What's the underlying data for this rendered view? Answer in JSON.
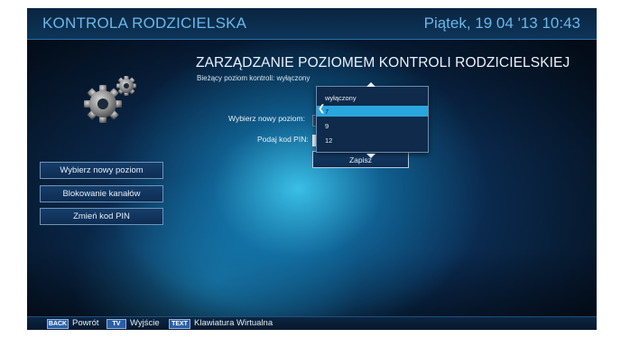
{
  "header": {
    "title": "KONTROLA RODZICIELSKA",
    "datetime": "Piątek, 19 04 '13 10:43"
  },
  "sidebar": {
    "items": [
      {
        "label": "Wybierz nowy poziom"
      },
      {
        "label": "Blokowanie kanałów"
      },
      {
        "label": "Zmień kod PIN"
      }
    ]
  },
  "main": {
    "title": "ZARZĄDZANIE POZIOMEM KONTROLI RODZICIELSKIEJ",
    "current_level": "Bieżący poziom kontroli: wyłączony",
    "select_level_label": "Wybierz nowy poziom:",
    "pin_label": "Podaj kod PIN:",
    "save_label": "Zapisz",
    "dropdown": {
      "options": [
        "wyłączony",
        "7",
        "9",
        "12"
      ],
      "highlighted": "7"
    }
  },
  "footer": {
    "hints": [
      {
        "key": "BACK",
        "label": "Powrót"
      },
      {
        "key": "TV",
        "label": "Wyjście"
      },
      {
        "key": "TEXT",
        "label": "Klawiatura Wirtualna"
      }
    ]
  },
  "colors": {
    "accent_text": "#6ab7e8",
    "highlight": "#2aa6de",
    "key_badge": "#2b5fa8"
  },
  "icons": [
    "gears-icon",
    "chevron-up-icon",
    "chevron-down-icon",
    "chevron-left-icon"
  ]
}
